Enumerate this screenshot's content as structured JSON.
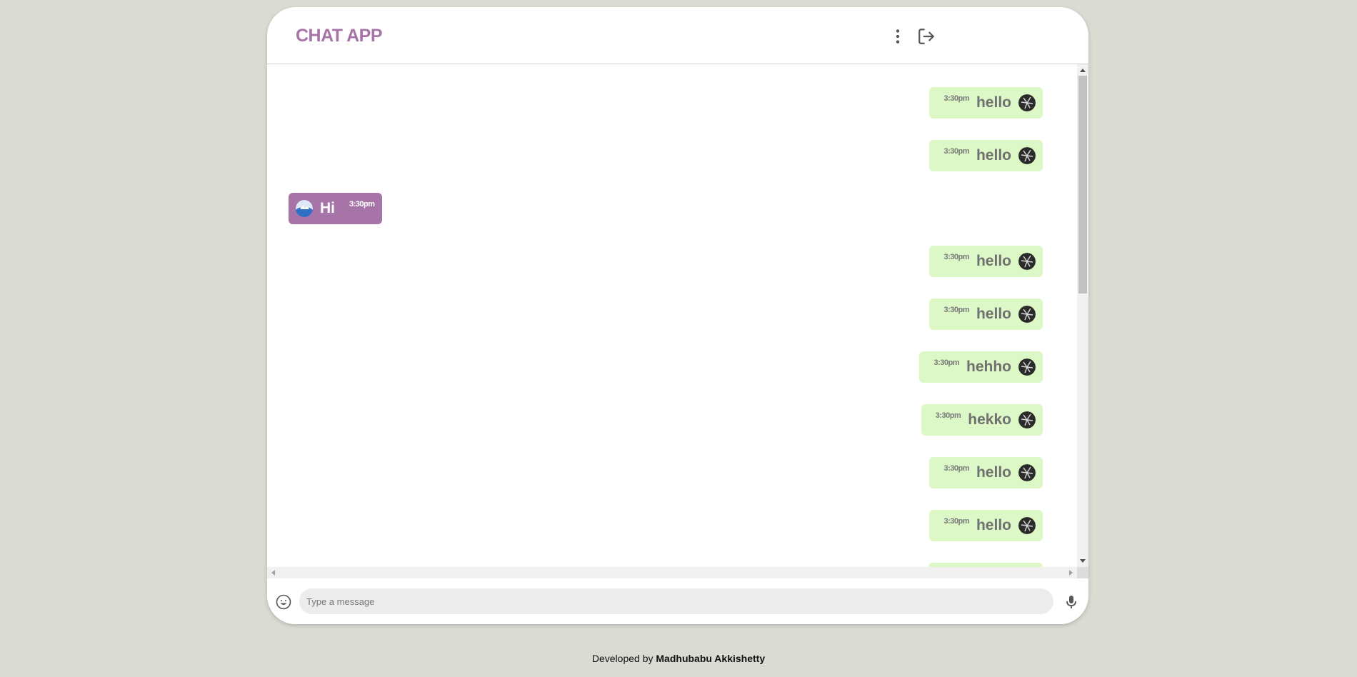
{
  "app": {
    "title": "CHAT APP"
  },
  "header": {
    "menu_icon": "more-vertical-icon",
    "logout_icon": "logout-icon"
  },
  "messages": [
    {
      "direction": "out",
      "text": "hello",
      "time": "3:30pm"
    },
    {
      "direction": "out",
      "text": "hello",
      "time": "3:30pm"
    },
    {
      "direction": "in",
      "text": "Hi",
      "time": "3:30pm"
    },
    {
      "direction": "out",
      "text": "hello",
      "time": "3:30pm"
    },
    {
      "direction": "out",
      "text": "hello",
      "time": "3:30pm"
    },
    {
      "direction": "out",
      "text": "hehho",
      "time": "3:30pm"
    },
    {
      "direction": "out",
      "text": "hekko",
      "time": "3:30pm"
    },
    {
      "direction": "out",
      "text": "hello",
      "time": "3:30pm"
    },
    {
      "direction": "out",
      "text": "hello",
      "time": "3:30pm"
    }
  ],
  "composer": {
    "placeholder": "Type a message",
    "emoji_icon": "emoji-icon",
    "mic_icon": "microphone-icon"
  },
  "footer": {
    "prefix": "Developed by",
    "author": "Madhubabu Akkishetty"
  },
  "colors": {
    "accent": "#a774a8",
    "outgoing": "#dcf8c6",
    "background": "#dadbd3"
  }
}
